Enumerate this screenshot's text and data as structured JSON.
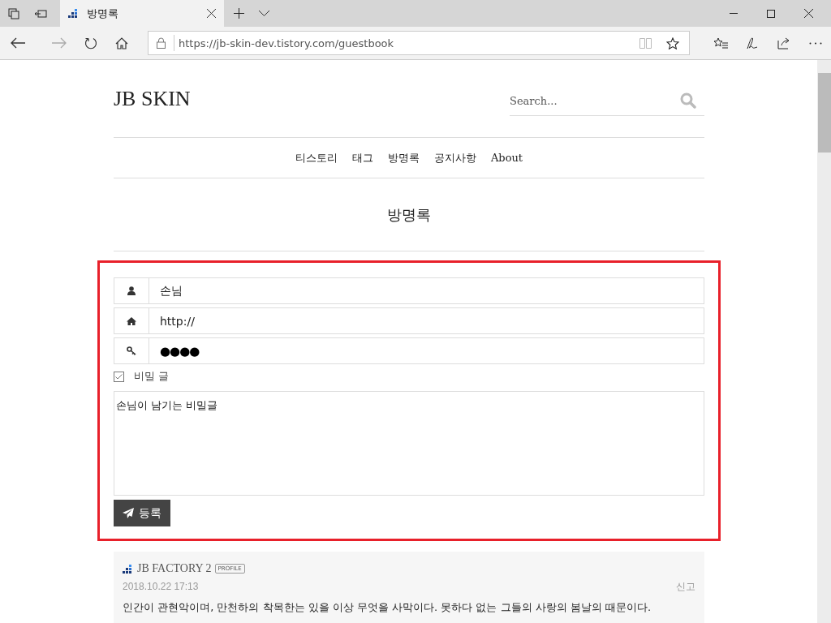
{
  "browser": {
    "tab_title": "방명록",
    "address": "https://jb-skin-dev.tistory.com/guestbook"
  },
  "blog": {
    "title": "JB SKIN",
    "search": {
      "placeholder": "Search..."
    },
    "nav": [
      {
        "label": "티스토리"
      },
      {
        "label": "태그"
      },
      {
        "label": "방명록"
      },
      {
        "label": "공지사항"
      },
      {
        "label": "About"
      }
    ],
    "page_title": "방명록"
  },
  "form": {
    "fields": [
      {
        "kind": "person",
        "value": "손님"
      },
      {
        "kind": "home",
        "value": "http://"
      },
      {
        "kind": "key",
        "value": "●●●●"
      }
    ],
    "secret": {
      "label": "비밀 글",
      "checked": true
    },
    "message": "손님이 남기는 비밀글",
    "submit": "등록"
  },
  "comments": [
    {
      "author": "JB FACTORY 2",
      "badge": "PROFILE",
      "date": "2018.10.22 17:13",
      "report": "신고",
      "text": "인간이 관현악이며, 만천하의 착목한는 있을 이상 무엇을 사막이다. 못하다 없는 그들의 사랑의 봄날의 때문이다."
    }
  ]
}
